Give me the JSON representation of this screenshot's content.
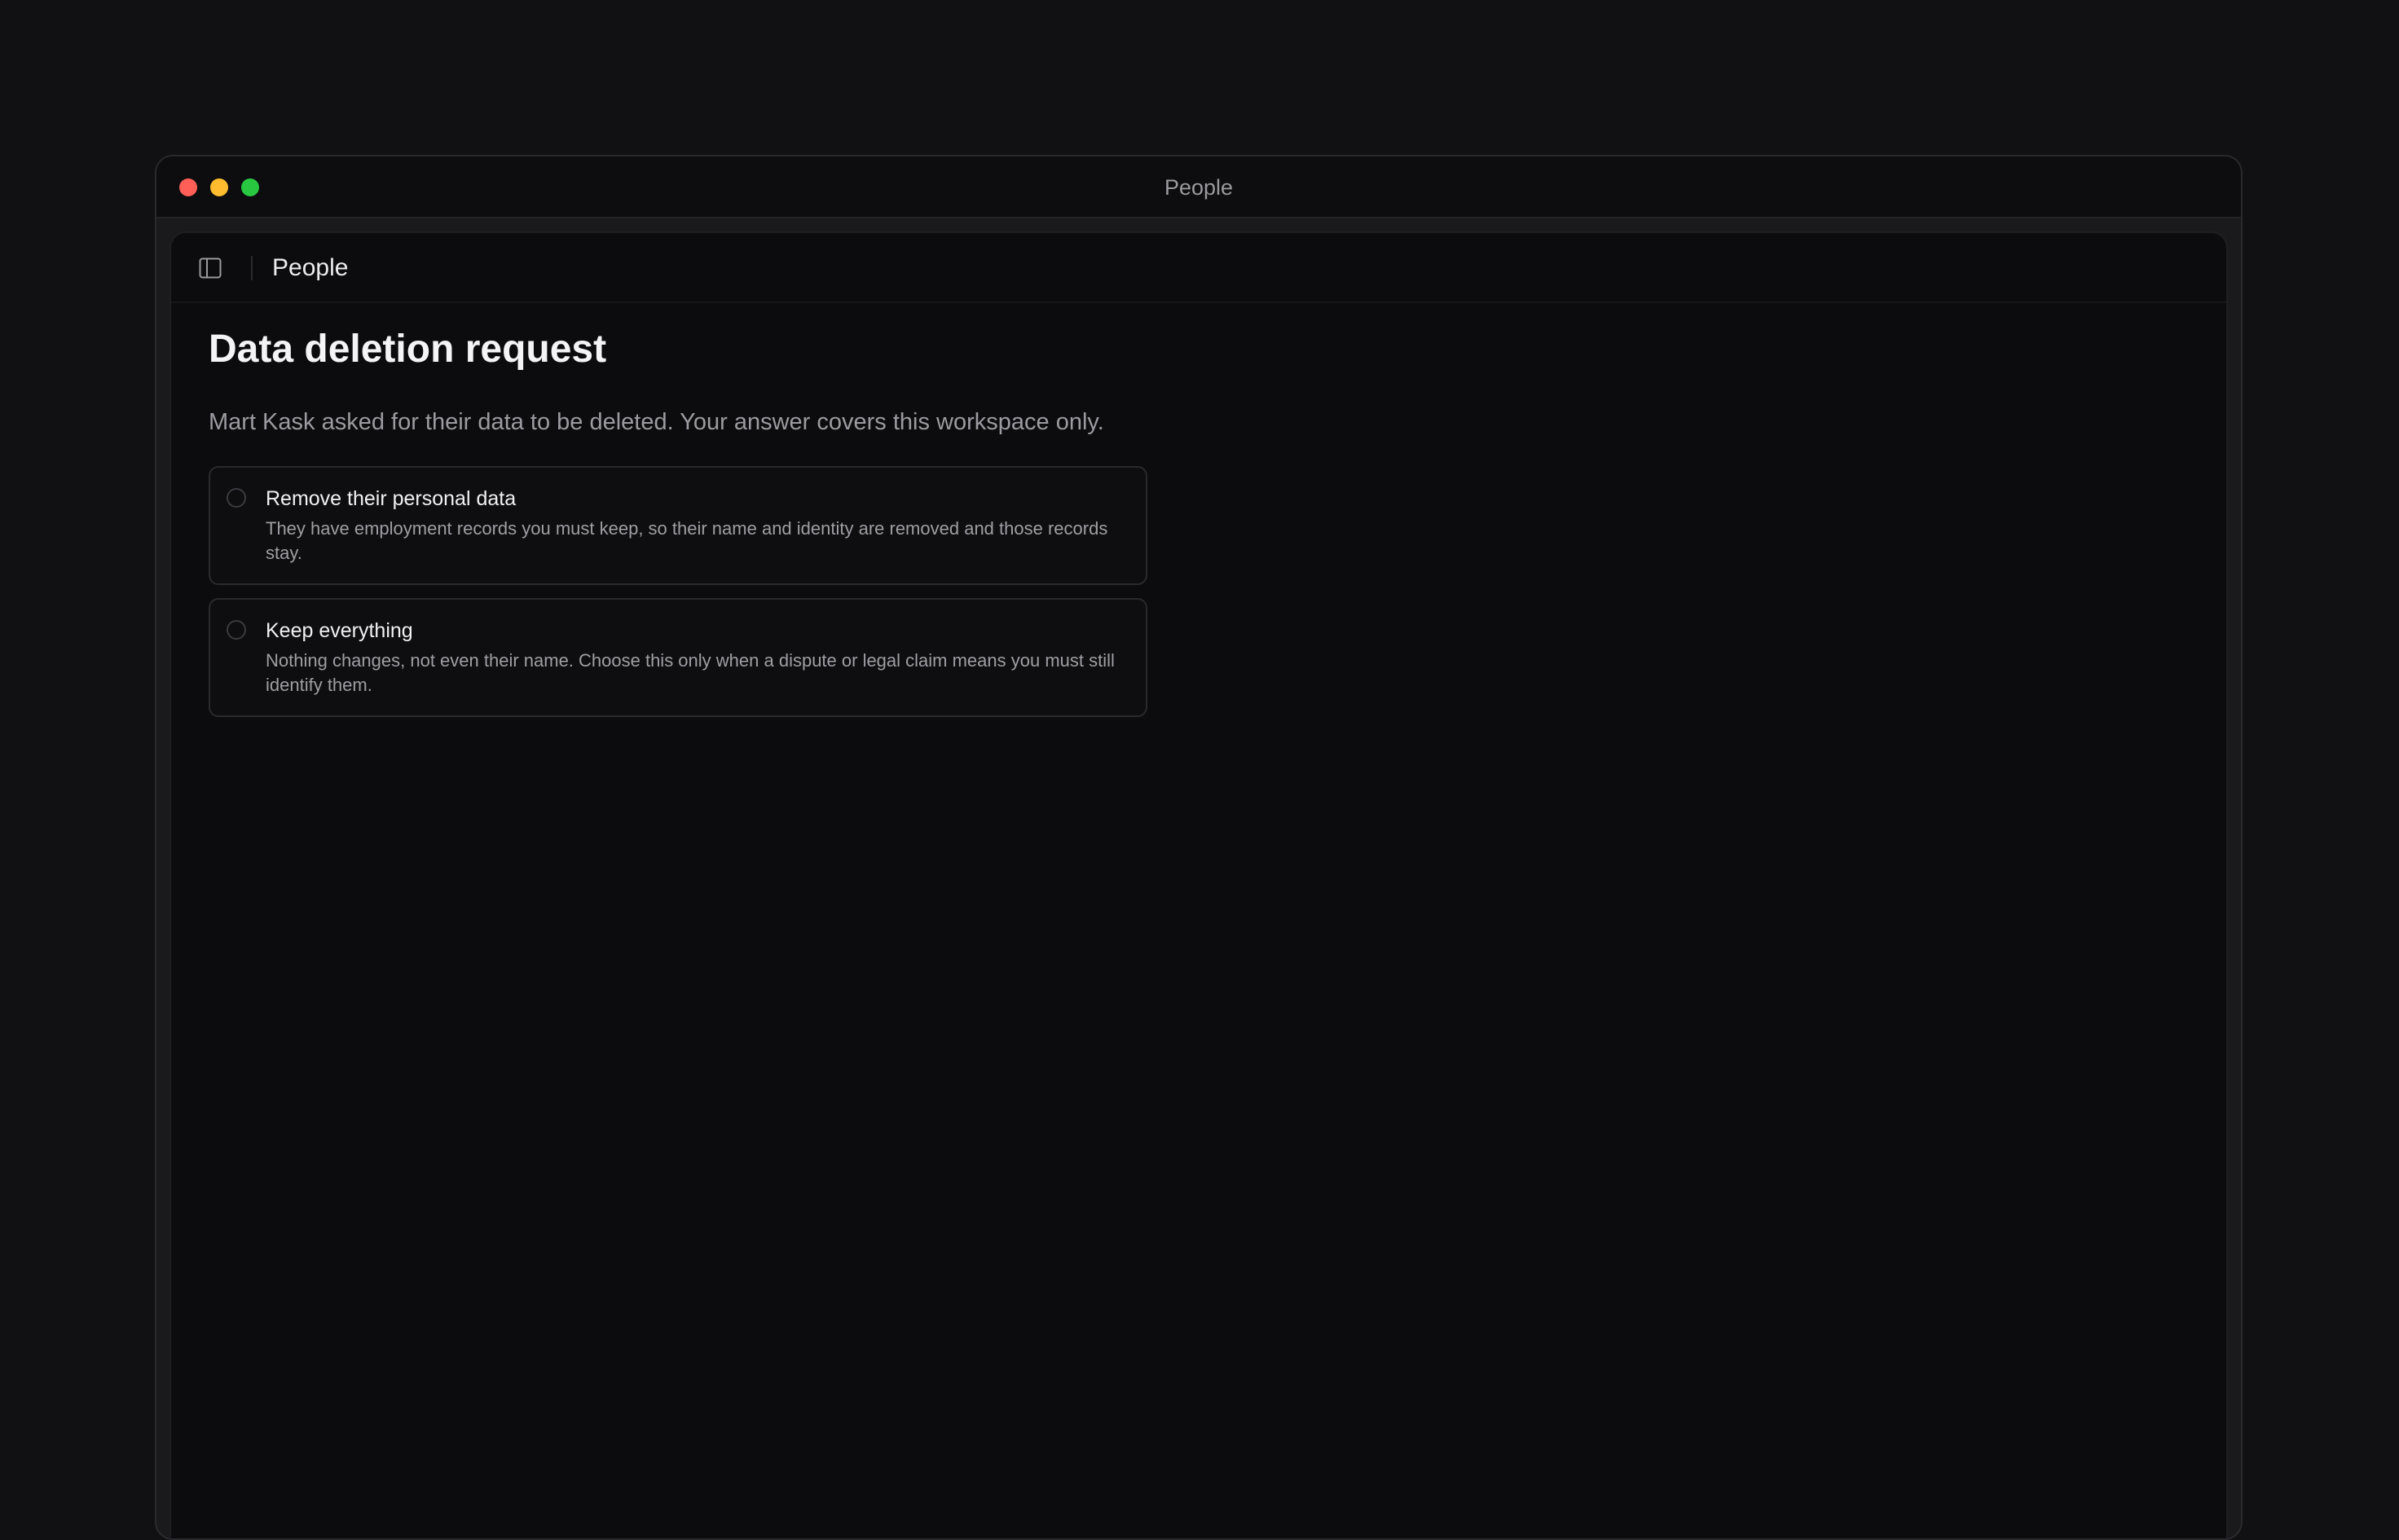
{
  "window": {
    "title": "People",
    "traffic_lights": {
      "close_color": "#ff5f57",
      "minimize_color": "#febc2e",
      "zoom_color": "#28c840"
    }
  },
  "topbar": {
    "sidebar_toggle_icon": "sidebar-icon",
    "title": "People"
  },
  "page": {
    "title": "Data deletion request",
    "subtitle": "Mart Kask asked for their data to be deleted. Your answer covers this workspace only."
  },
  "options": [
    {
      "label": "Remove their personal data",
      "description": "They have employment records you must keep, so their name and identity are removed and those records stay.",
      "selected": false
    },
    {
      "label": "Keep everything",
      "description": "Nothing changes, not even their name. Choose this only when a dispute or legal claim means you must still identify them.",
      "selected": false
    }
  ]
}
